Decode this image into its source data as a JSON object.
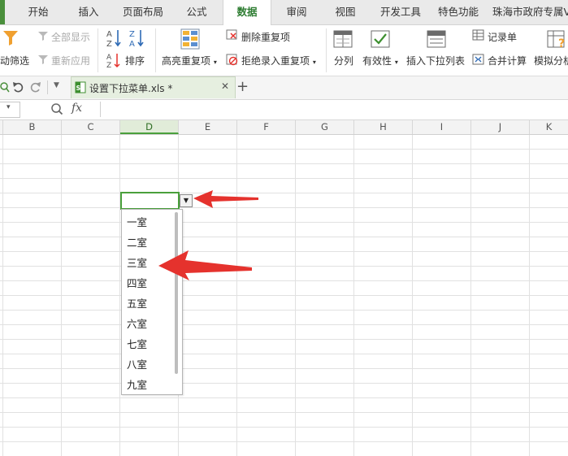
{
  "ribbon_tabs": [
    "开始",
    "插入",
    "页面布局",
    "公式",
    "数据",
    "审阅",
    "视图",
    "开发工具",
    "特色功能",
    "珠海市政府专属V"
  ],
  "active_tab": "数据",
  "ribbon": {
    "auto_filter": "动筛选",
    "show_all": "全部显示",
    "reapply": "重新应用",
    "sort": "排序",
    "highlight_duplicates": "高亮重复项",
    "remove_duplicates": "删除重复项",
    "reject_duplicates": "拒绝录入重复项",
    "split_columns": "分列",
    "validity": "有效性",
    "insert_dropdown": "插入下拉列表",
    "record_sheet": "记录单",
    "consolidate": "合并计算",
    "what_if": "模拟分析"
  },
  "document_tab": {
    "filename": "设置下拉菜单.xls *"
  },
  "formula_bar": {
    "fx_label": "fx",
    "value": ""
  },
  "columns": [
    "B",
    "C",
    "D",
    "E",
    "F",
    "G",
    "H",
    "I",
    "J",
    "K"
  ],
  "selected_column": "D",
  "dropdown_items": [
    "一室",
    "二室",
    "三室",
    "四室",
    "五室",
    "六室",
    "七室",
    "八室",
    "九室"
  ],
  "colors": {
    "accent_green": "#4aa03c",
    "arrow_red": "#e5322d"
  }
}
